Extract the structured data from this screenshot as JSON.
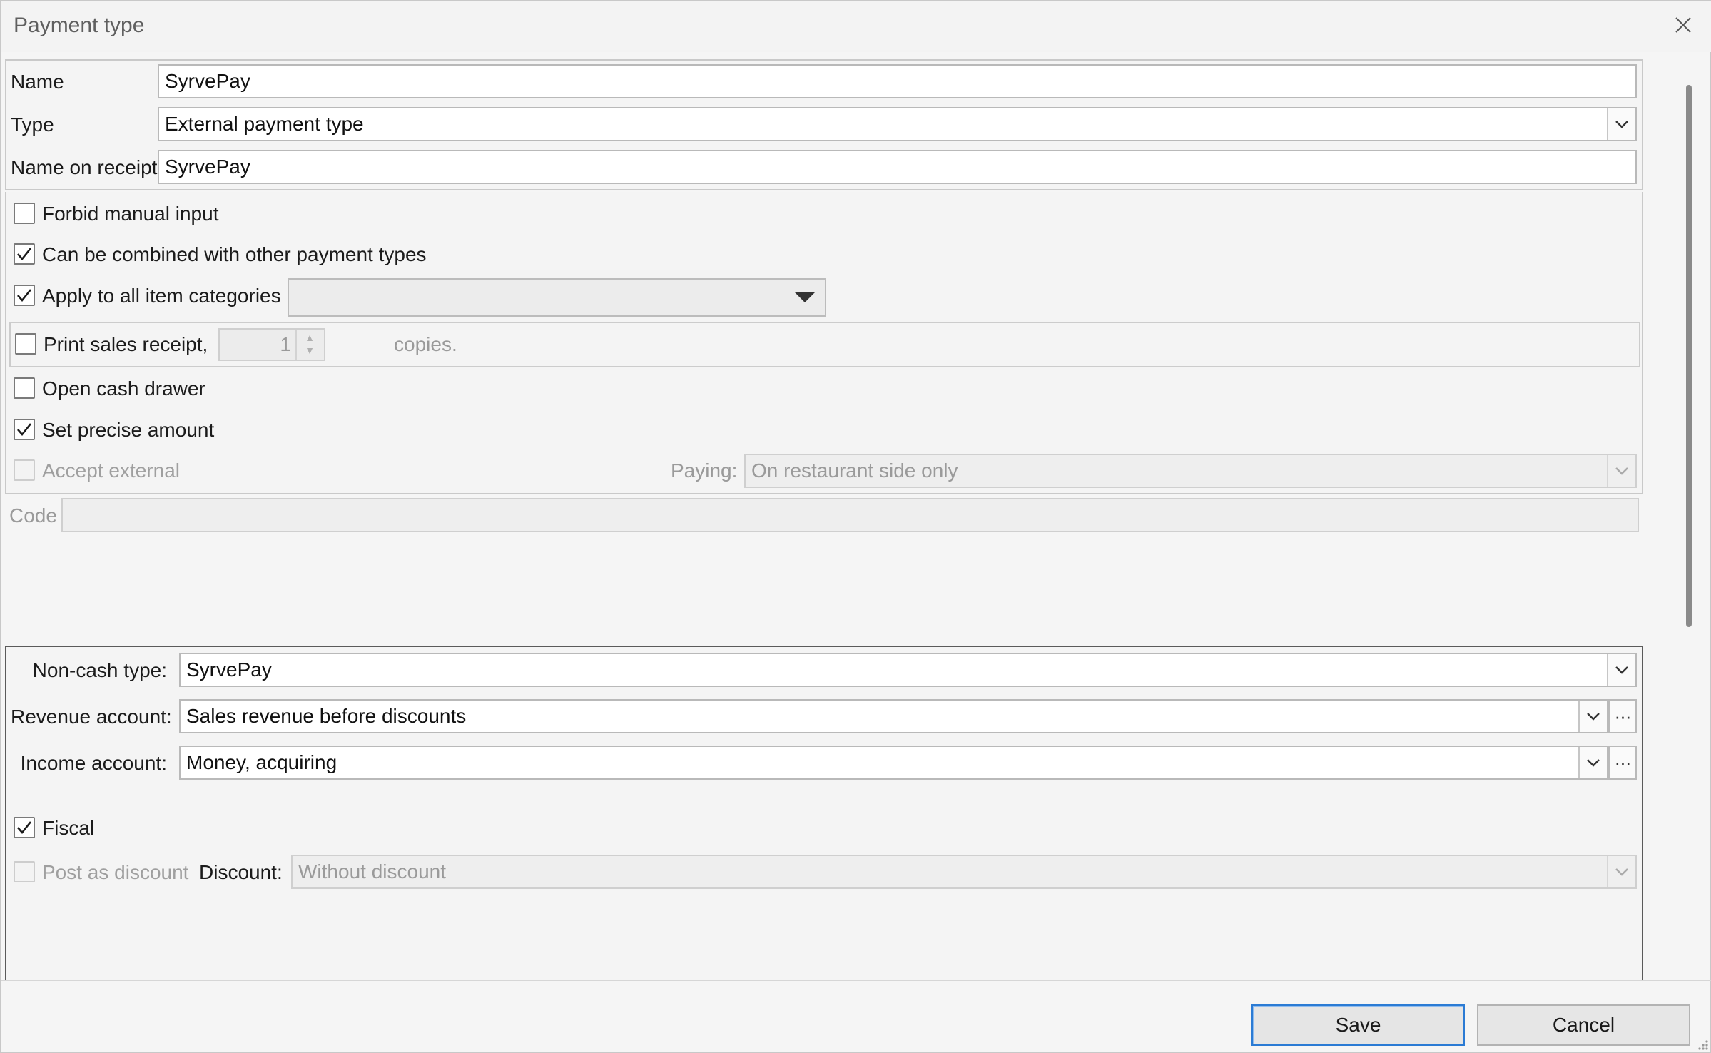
{
  "window": {
    "title": "Payment type",
    "close_icon": "close-icon"
  },
  "general": {
    "name_label": "Name",
    "name_value": "SyrvePay",
    "type_label": "Type",
    "type_value": "External payment type",
    "receipt_label": "Name on receipt",
    "receipt_value": "SyrvePay"
  },
  "options": {
    "forbid_manual_input": {
      "label": "Forbid manual input",
      "checked": false,
      "enabled": true
    },
    "combined": {
      "label": "Can be combined with other payment types",
      "checked": true,
      "enabled": true
    },
    "apply_all_categories": {
      "label": "Apply to all item categories",
      "checked": true,
      "enabled": true,
      "category_value": ""
    },
    "print_receipt": {
      "label": "Print sales receipt,",
      "checked": false,
      "enabled": true,
      "copies_value": "1",
      "copies_label": "copies."
    },
    "open_cash_drawer": {
      "label": "Open cash drawer",
      "checked": false,
      "enabled": true
    },
    "set_precise_amount": {
      "label": "Set precise amount",
      "checked": true,
      "enabled": true
    },
    "accept_external": {
      "label": "Accept external",
      "checked": false,
      "enabled": false
    },
    "paying_label": "Paying:",
    "paying_value": "On restaurant side only",
    "code_label": "Code",
    "code_value": ""
  },
  "accounting": {
    "noncash_label": "Non-cash type:",
    "noncash_value": "SyrvePay",
    "revenue_label": "Revenue account:",
    "revenue_value": "Sales revenue before discounts",
    "income_label": "Income account:",
    "income_value": "Money, acquiring",
    "more_glyph": "···",
    "fiscal": {
      "label": "Fiscal",
      "checked": true,
      "enabled": true
    },
    "post_as_discount": {
      "label": "Post as discount",
      "checked": false,
      "enabled": false
    },
    "discount_label": "Discount:",
    "discount_value": "Without discount"
  },
  "footer": {
    "save_label": "Save",
    "cancel_label": "Cancel"
  },
  "colors": {
    "window_bg": "#f5f5f5",
    "accent": "#2b7bd4",
    "disabled_text": "#9a9a9a"
  }
}
